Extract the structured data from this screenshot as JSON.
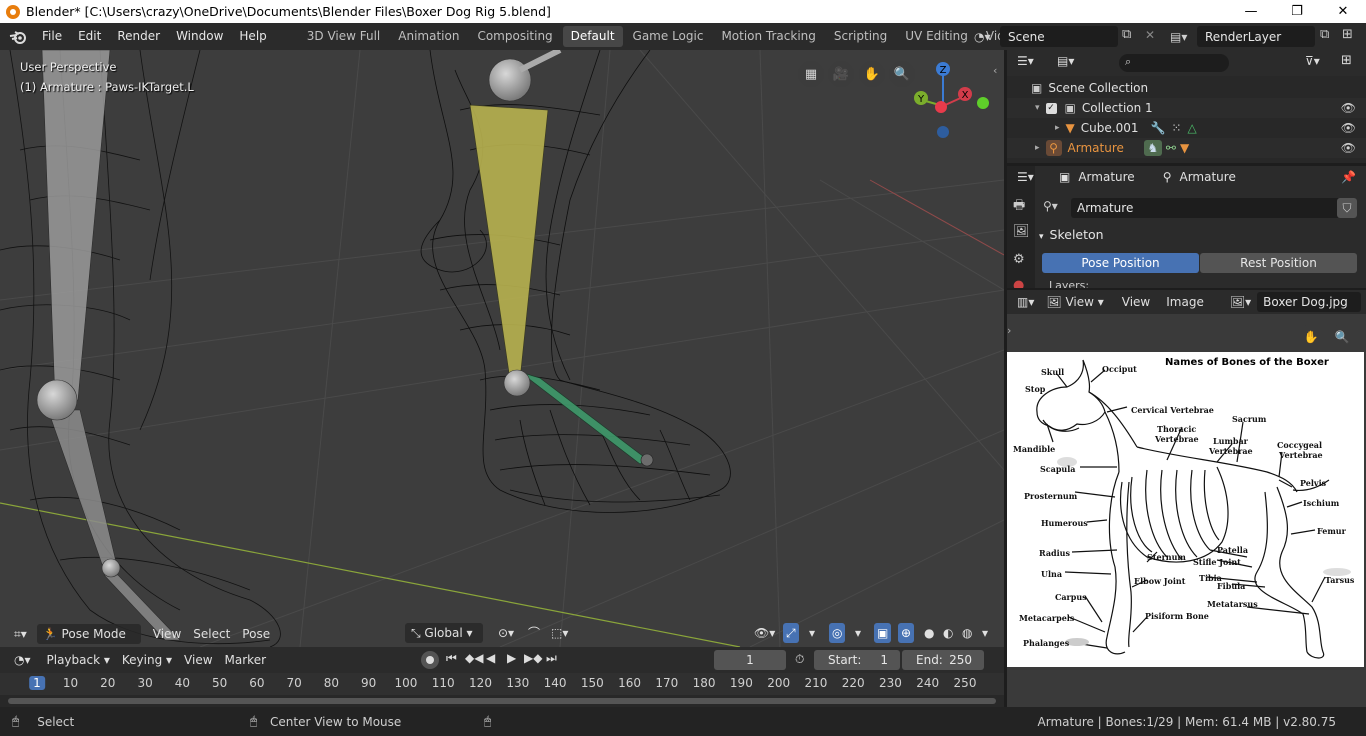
{
  "window": {
    "title": "Blender* [C:\\Users\\crazy\\OneDrive\\Documents\\Blender Files\\Boxer Dog Rig 5.blend]",
    "minimize": "—",
    "maximize": "❐",
    "close": "✕"
  },
  "menu": [
    "File",
    "Edit",
    "Render",
    "Window",
    "Help"
  ],
  "workspaces": [
    {
      "label": "3D View Full"
    },
    {
      "label": "Animation"
    },
    {
      "label": "Compositing"
    },
    {
      "label": "Default",
      "active": true
    },
    {
      "label": "Game Logic"
    },
    {
      "label": "Motion Tracking"
    },
    {
      "label": "Scripting"
    },
    {
      "label": "UV Editing"
    },
    {
      "label": "Video Editing"
    }
  ],
  "workspace_add": "+",
  "scene": {
    "name": "Scene",
    "view_layer": "RenderLayer"
  },
  "viewport": {
    "perspective": "User Perspective",
    "active_object": "(1) Armature : Paws-IKTarget.L",
    "mode": "Pose Mode",
    "menus": [
      "View",
      "Select",
      "Pose"
    ],
    "orientation": "Global",
    "gizmo_axes": {
      "z": "Z",
      "y": "Y",
      "x": "X"
    }
  },
  "timeline": {
    "menus": [
      "Playback",
      "Keying",
      "View",
      "Marker"
    ],
    "current_frame": "1",
    "start_label": "Start:",
    "start": "1",
    "end_label": "End:",
    "end": "250",
    "ruler": [
      "1",
      "10",
      "20",
      "30",
      "40",
      "50",
      "60",
      "70",
      "80",
      "90",
      "100",
      "110",
      "120",
      "130",
      "140",
      "150",
      "160",
      "170",
      "180",
      "190",
      "200",
      "210",
      "220",
      "230",
      "240",
      "250"
    ]
  },
  "outliner": {
    "rows": [
      {
        "label": "Scene Collection"
      },
      {
        "label": "Collection 1"
      },
      {
        "label": "Cube.001"
      },
      {
        "label": "Armature"
      }
    ]
  },
  "properties": {
    "breadcrumb_object": "Armature",
    "breadcrumb_data": "Armature",
    "datablock": "Armature",
    "panel_title": "Skeleton",
    "pose_position": "Pose Position",
    "rest_position": "Rest Position",
    "layers_label": "Layers:"
  },
  "image_editor": {
    "menus": [
      "View",
      "View",
      "Image"
    ],
    "image_name": "Boxer Dog.jpg",
    "diagram_title": "Names of Bones of the Boxer",
    "labels": {
      "skull": "Skull",
      "occiput": "Occiput",
      "stop": "Stop",
      "cervical": "Cervical Vertebrae",
      "sacrum": "Sacrum",
      "thoracic1": "Thoracic",
      "thoracic2": "Vertebrae",
      "lumbar1": "Lumbar",
      "lumbar2": "Vertebrae",
      "coccygeal1": "Coccygeal",
      "coccygeal2": "Vertebrae",
      "mandible": "Mandible",
      "scapula": "Scapula",
      "pelvis": "Pelvis",
      "prosternum": "Prosternum",
      "ischium": "Ischium",
      "humerous": "Humerous",
      "femur": "Femur",
      "radius": "Radius",
      "sternum": "Sternum",
      "patella": "Patella",
      "stifle": "Stifle Joint",
      "ulna": "Ulna",
      "elbow": "Elbow Joint",
      "tibia": "Tibia",
      "tarsus": "Tarsus",
      "fibula": "Fibula",
      "carpus": "Carpus",
      "metatarsus": "Metatarsus",
      "metacarpels": "Metacarpels",
      "pisiform": "Pisiform Bone",
      "phalanges": "Phalanges"
    }
  },
  "status": {
    "select": "Select",
    "center_view": "Center View to Mouse",
    "info": "Armature | Bones:1/29 | Mem: 61.4 MB | v2.80.75"
  },
  "colors": {
    "accent": "#4772b3",
    "bone_selected": "#b8b24f",
    "bone_ik": "#3f9a6b",
    "active_object": "#e89440"
  }
}
